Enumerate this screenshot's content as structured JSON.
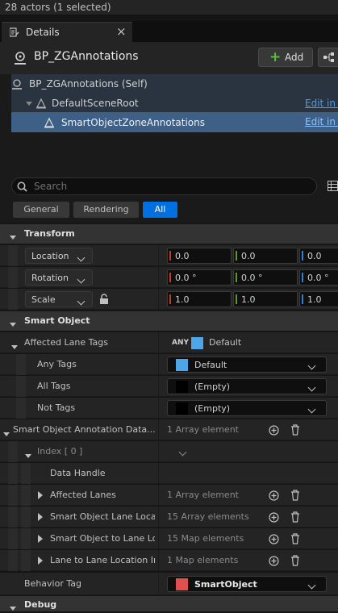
{
  "status": {
    "actors": "28 actors (1 selected)"
  },
  "tab": {
    "label": "Details",
    "close": "×"
  },
  "header": {
    "title": "BP_ZGAnnotations",
    "add_label": "Add"
  },
  "tree": {
    "items": [
      {
        "label": "BP_ZGAnnotations (Self)",
        "action": ""
      },
      {
        "label": "DefaultSceneRoot",
        "action": "Edit in B"
      },
      {
        "label": "SmartObjectZoneAnnotations",
        "action": "Edit in B"
      }
    ]
  },
  "search": {
    "placeholder": "Search"
  },
  "filters": {
    "general": "General",
    "rendering": "Rendering",
    "all": "All"
  },
  "transform": {
    "title": "Transform",
    "location": {
      "label": "Location",
      "x": "0.0",
      "y": "0.0",
      "z": "0.0"
    },
    "rotation": {
      "label": "Rotation",
      "x": "0.0 °",
      "y": "0.0 °",
      "z": "0.0 °"
    },
    "scale": {
      "label": "Scale",
      "x": "1.0",
      "y": "1.0",
      "z": "1.0"
    }
  },
  "smart_object": {
    "title": "Smart Object",
    "affected_lane_tags": {
      "label": "Affected Lane Tags",
      "mode": "ANY",
      "value": "Default"
    },
    "any_tags": {
      "label": "Any Tags",
      "value": "Default"
    },
    "all_tags": {
      "label": "All Tags",
      "value": "(Empty)"
    },
    "not_tags": {
      "label": "Not Tags",
      "value": "(Empty)"
    },
    "annotation_data": {
      "label": "Smart Object Annotation Data...",
      "value": "1 Array element"
    },
    "index": {
      "label": "Index [ 0 ]"
    },
    "data_handle": {
      "label": "Data Handle"
    },
    "affected_lanes": {
      "label": "Affected Lanes",
      "value": "1 Array element"
    },
    "lane_locations": {
      "label": "Smart Object Lane Loca...",
      "value": "15 Array elements"
    },
    "object_to_lane": {
      "label": "Smart Object to Lane Lo...",
      "value": "15 Map elements"
    },
    "lane_to_lane": {
      "label": "Lane to Lane Location In...",
      "value": "1 Map elements"
    },
    "behavior_tag": {
      "label": "Behavior Tag",
      "value": "SmartObject"
    }
  },
  "debug": {
    "title": "Debug"
  },
  "colors": {
    "accent": "#0070e0",
    "x_axis": "#c63a2c",
    "y_axis": "#5a9a28",
    "z_axis": "#2f7fd6",
    "tag_blue": "#4ea6e8",
    "tag_red": "#e05050"
  }
}
